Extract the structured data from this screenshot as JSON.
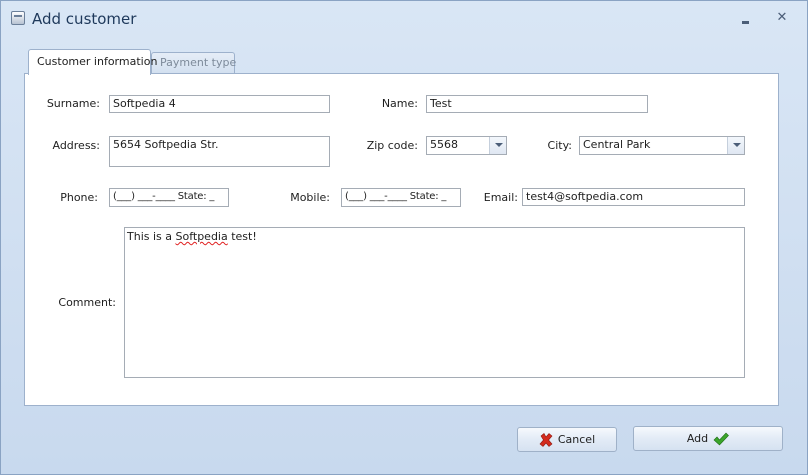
{
  "window": {
    "title": "Add customer",
    "minimize_glyph": "",
    "close_glyph": "✕"
  },
  "tabs": [
    {
      "label": "Customer information",
      "active": true
    },
    {
      "label": "Payment type",
      "active": false
    }
  ],
  "form": {
    "surname": {
      "label": "Surname:",
      "value": "Softpedia 4"
    },
    "name": {
      "label": "Name:",
      "value": "Test"
    },
    "address": {
      "label": "Address:",
      "value": "5654 Softpedia Str."
    },
    "zip_code": {
      "label": "Zip code:",
      "value": "5568"
    },
    "city": {
      "label": "City:",
      "value": "Central Park"
    },
    "phone": {
      "label": "Phone:",
      "value": "(___) ___-____ State: _"
    },
    "mobile": {
      "label": "Mobile:",
      "value": "(___) ___-____ State: _"
    },
    "email": {
      "label": "Email:",
      "value": "test4@softpedia.com"
    },
    "comment": {
      "label": "Comment:",
      "value_prefix": "This is a ",
      "value_misspelled": "Softpedia",
      "value_suffix": " test!"
    }
  },
  "buttons": {
    "cancel_label": "Cancel",
    "add_label": "Add"
  },
  "icons": {
    "app": "window-icon",
    "cancel": "red-x-icon",
    "add": "green-check-icon"
  },
  "colors": {
    "cancel_icon": "#d42b1e",
    "add_icon": "#3ba52b",
    "background": "#cddcee"
  }
}
